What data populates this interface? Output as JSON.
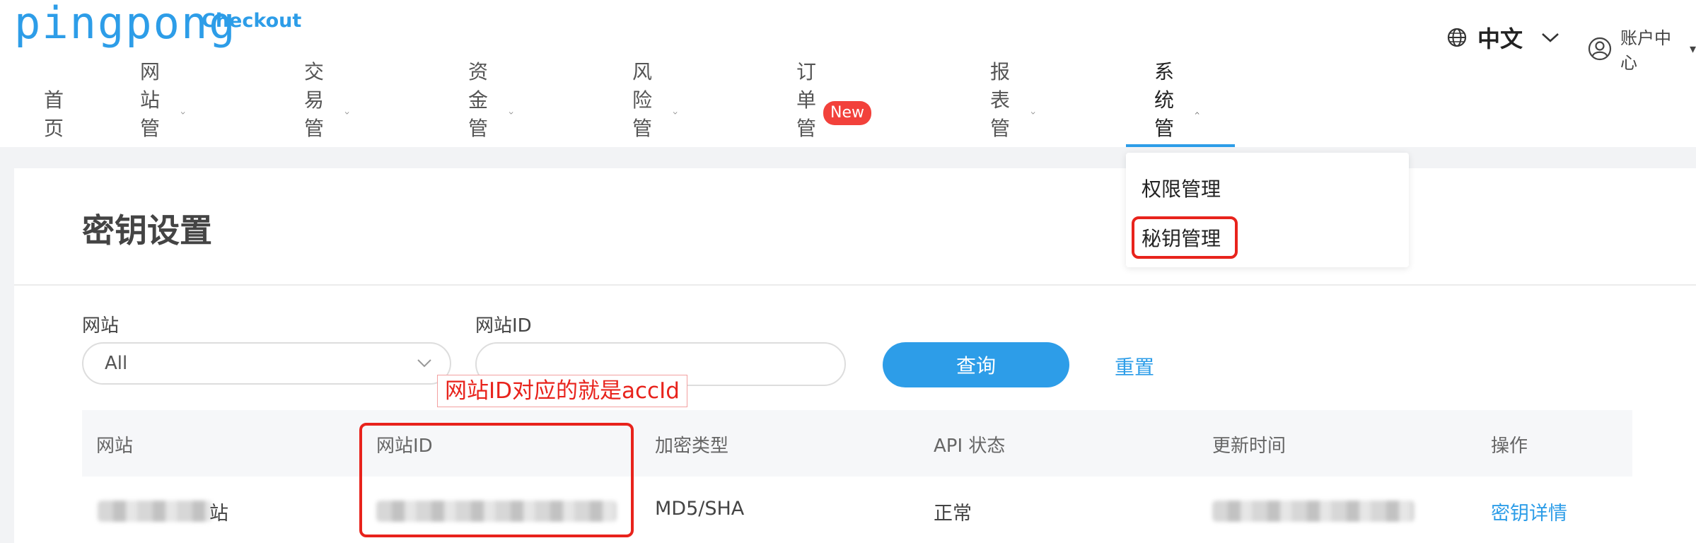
{
  "brand": {
    "name": "pingpong",
    "product": "Checkout"
  },
  "header": {
    "language": "中文",
    "account": "账户中心"
  },
  "nav": {
    "items": [
      {
        "label": "首页"
      },
      {
        "label": "网站管理"
      },
      {
        "label": "交易管理"
      },
      {
        "label": "资金管理"
      },
      {
        "label": "风险管理"
      },
      {
        "label": "订单管理",
        "badge": "New"
      },
      {
        "label": "报表管理"
      },
      {
        "label": "系统管理"
      }
    ],
    "active": "系统管理",
    "dropdown": [
      "权限管理",
      "秘钥管理"
    ]
  },
  "page": {
    "title": "密钥设置"
  },
  "filters": {
    "site_label": "网站",
    "site_value": "All",
    "site_id_label": "网站ID",
    "site_id_value": "",
    "query_button": "查询",
    "reset_button": "重置"
  },
  "annotation": "网站ID对应的就是accId",
  "table": {
    "headers": [
      "网站",
      "网站ID",
      "加密类型",
      "API 状态",
      "更新时间",
      "操作"
    ],
    "rows": [
      {
        "site": "站",
        "site_id": "",
        "encryption": "MD5/SHA",
        "api_status": "正常",
        "updated": "",
        "action": "密钥详情"
      }
    ]
  },
  "colors": {
    "accent": "#2d9de8",
    "badge": "#f2413b",
    "annotation": "#e8231c"
  }
}
